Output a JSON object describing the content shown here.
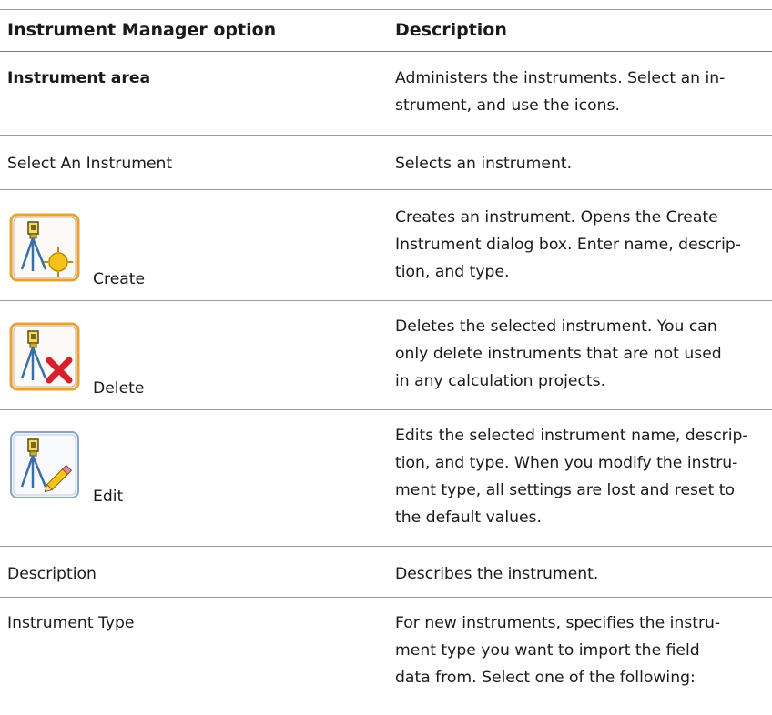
{
  "table": {
    "header": {
      "option": "Instrument Manager option",
      "description": "Description"
    },
    "rows": [
      {
        "option": "Instrument area",
        "description": [
          "Administers the instruments. Select an in-",
          "strument, and use the icons."
        ]
      },
      {
        "option": "Select An Instrument",
        "description": [
          "Selects an instrument."
        ]
      },
      {
        "option": "Create",
        "icon": "create-instrument-icon",
        "description": [
          "Creates an instrument. Opens the Create",
          "Instrument dialog box. Enter name, descrip-",
          "tion, and type."
        ]
      },
      {
        "option": "Delete",
        "icon": "delete-instrument-icon",
        "description": [
          "Deletes the selected instrument. You can",
          "only delete instruments that are not used",
          "in any calculation projects."
        ]
      },
      {
        "option": "Edit",
        "icon": "edit-instrument-icon",
        "description": [
          "Edits the selected instrument name, descrip-",
          "tion, and type. When you modify the instru-",
          "ment type, all settings are lost and reset to",
          "the default values."
        ]
      },
      {
        "option": "Description",
        "description": [
          "Describes the instrument."
        ]
      },
      {
        "option": "Instrument Type",
        "description": [
          "For new instruments, specifies the instru-",
          "ment type you want to import the field",
          "data from. Select one of the following:"
        ]
      }
    ]
  },
  "colors": {
    "rule": "#9a9a9a",
    "icon_frame_selected": "#e8a23a",
    "icon_frame_normal": "#8aa4c8",
    "delete_mark": "#d8202a",
    "create_mark": "#f3c21b"
  }
}
